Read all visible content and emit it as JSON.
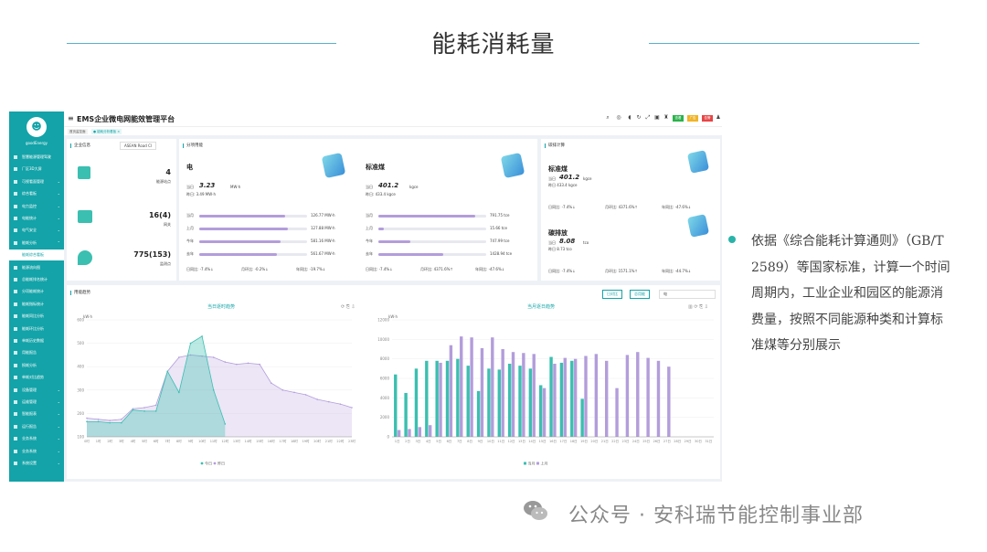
{
  "slide": {
    "title": "能耗消耗量",
    "bullet": [
      "依据《综合能耗计算通则》（GB/T",
      "2589）等国家标准，计算一个时间",
      "周期内，工业企业和园区的能源消",
      "费量，按照不同能源种类和计算标",
      "准煤等分别展示"
    ],
    "watermark": "公众号 · 安科瑞节能控制事业部",
    "accent": "#2ab3a8"
  },
  "app": {
    "title": "EMS企业微电网能效管理平台",
    "logo_name": "goodEnergy",
    "tabs": [
      "首页监控面",
      "● 能耗分析看板 ×"
    ],
    "sidebar": [
      {
        "label": "智慧能源管理驾驶",
        "chev": "",
        "active": false
      },
      {
        "label": "厂区3D大屏",
        "chev": "",
        "active": false
      },
      {
        "label": "可视看面管理",
        "chev": "⌄",
        "active": false
      },
      {
        "label": "综合看板",
        "chev": "⌄",
        "active": false
      },
      {
        "label": "电力监控",
        "chev": "⌄",
        "active": false
      },
      {
        "label": "电能统计",
        "chev": "⌄",
        "active": false
      },
      {
        "label": "电气安全",
        "chev": "⌄",
        "active": false
      },
      {
        "label": "能耗分析",
        "chev": "⌃",
        "active": false
      },
      {
        "label": "能耗综合看板",
        "chev": "",
        "active": true
      },
      {
        "label": "能源流向图",
        "chev": "",
        "active": false
      },
      {
        "label": "总能耗排名统计",
        "chev": "",
        "active": false
      },
      {
        "label": "分项能耗统计",
        "chev": "",
        "active": false
      },
      {
        "label": "能耗指标统计",
        "chev": "",
        "active": false
      },
      {
        "label": "能耗同比分析",
        "chev": "",
        "active": false
      },
      {
        "label": "能耗环比分析",
        "chev": "",
        "active": false
      },
      {
        "label": "单耗历史数据",
        "chev": "",
        "active": false
      },
      {
        "label": "用能报告",
        "chev": "",
        "active": false
      },
      {
        "label": "损耗分析",
        "chev": "",
        "active": false
      },
      {
        "label": "单耗对比趋势",
        "chev": "",
        "active": false
      },
      {
        "label": "设备管理",
        "chev": "⌄",
        "active": false
      },
      {
        "label": "运维管理",
        "chev": "⌄",
        "active": false
      },
      {
        "label": "智能报表",
        "chev": "⌄",
        "active": false
      },
      {
        "label": "运行报告",
        "chev": "⌄",
        "active": false
      },
      {
        "label": "业务系统",
        "chev": "⌄",
        "active": false
      },
      {
        "label": "业务系统",
        "chev": "⌄",
        "active": false
      },
      {
        "label": "系统设置",
        "chev": "⌄",
        "active": false
      }
    ],
    "badges": [
      {
        "label": "查看",
        "color": "#2ab34b"
      },
      {
        "label": "广告",
        "color": "#f0b428"
      },
      {
        "label": "告警",
        "color": "#e84545"
      }
    ],
    "enterprise": {
      "title": "企业信息",
      "name": "ASEAN Road Cl",
      "stats": [
        {
          "value": "4",
          "label": "能源站点"
        },
        {
          "value": "16(4)",
          "label": "网关"
        },
        {
          "value": "775(153)",
          "label": "监测点"
        }
      ]
    },
    "energy": {
      "title": "分项用能",
      "items": [
        {
          "name": "电",
          "today_label": "当日",
          "today_value": "3.23",
          "today_unit": "MW·h",
          "yest": "昨日: 3.49 MW·h",
          "rows": [
            {
              "k": "当月",
              "v": "126.77 MW·h",
              "p": 0.8
            },
            {
              "k": "上月",
              "v": "127.88 MW·h",
              "p": 0.82
            },
            {
              "k": "今年",
              "v": "581.16 MW·h",
              "p": 0.75
            },
            {
              "k": "去年",
              "v": "561.67 MW·h",
              "p": 0.72
            }
          ],
          "ratios": [
            "日同比: -7.4%↓",
            "月环比: -0.2%↓",
            "年同比: -19.7%↓"
          ]
        },
        {
          "name": "标准煤",
          "today_label": "当日",
          "today_value": "401.2",
          "today_unit": "kgce",
          "yest": "昨日: 433.4 kgce",
          "rows": [
            {
              "k": "当月",
              "v": "791.75 tce",
              "p": 0.9
            },
            {
              "k": "上月",
              "v": "15.66 tce",
              "p": 0.05
            },
            {
              "k": "今年",
              "v": "747.99 tce",
              "p": 0.3
            },
            {
              "k": "去年",
              "v": "1428.94 tce",
              "p": 0.6
            }
          ],
          "ratios": [
            "日同比: -7.4%↓",
            "月环比: 4371.6%↑",
            "年同比: -47.6%↓"
          ]
        }
      ]
    },
    "carbon": {
      "title": "碳排计算",
      "items": [
        {
          "name": "标准煤",
          "today_label": "当日",
          "today_value": "401.2",
          "today_unit": "kgce",
          "yest": "昨日 433.4 kgce",
          "ratios": [
            "日同比: -7.4%↓",
            "月环比: 4371.6%↑",
            "年同比: -47.6%↓"
          ]
        },
        {
          "name": "碳排放",
          "today_label": "当日",
          "today_value": "8.08",
          "today_unit": "tco",
          "yest": "昨日 8.73 tco",
          "ratios": [
            "日同比: -7.4%↓",
            "月环比: 1571.1%↑",
            "年同比: -44.7%↓"
          ]
        }
      ]
    },
    "trend": {
      "title": "用能趋势",
      "btn1": "日对比",
      "btn2": "总用能",
      "select": "电",
      "day_title": "当日逐时趋势",
      "month_title": "当月逐日趋势",
      "unit_left": "kW·h",
      "unit_right": "kW·h",
      "legend_left": [
        "今日",
        "昨日"
      ],
      "legend_right": [
        "当月",
        "上月"
      ]
    }
  },
  "chart_data": [
    {
      "type": "area",
      "title": "当日逐时趋势",
      "ylabel": "kW·h",
      "ylim": [
        100,
        600
      ],
      "x": [
        "0时",
        "1时",
        "2时",
        "3时",
        "4时",
        "5时",
        "6时",
        "7时",
        "8时",
        "9时",
        "10时",
        "11时",
        "12时",
        "13时",
        "14时",
        "15时",
        "16时",
        "17时",
        "18时",
        "19时",
        "20时",
        "21时",
        "22时",
        "23时"
      ],
      "series": [
        {
          "name": "今日",
          "values": [
            165,
            165,
            160,
            160,
            215,
            210,
            210,
            380,
            290,
            500,
            530,
            300,
            155,
            null,
            null,
            null,
            null,
            null,
            null,
            null,
            null,
            null,
            null,
            null
          ]
        },
        {
          "name": "昨日",
          "values": [
            180,
            175,
            170,
            175,
            220,
            225,
            235,
            380,
            440,
            450,
            445,
            440,
            420,
            410,
            415,
            410,
            330,
            300,
            290,
            280,
            260,
            250,
            240,
            225
          ]
        }
      ]
    },
    {
      "type": "bar",
      "title": "当月逐日趋势",
      "ylabel": "kW·h",
      "ylim": [
        0,
        12000
      ],
      "x": [
        "1日",
        "2日",
        "3日",
        "4日",
        "5日",
        "6日",
        "7日",
        "8日",
        "9日",
        "10日",
        "11日",
        "12日",
        "13日",
        "14日",
        "15日",
        "16日",
        "17日",
        "18日",
        "19日",
        "20日",
        "21日",
        "22日",
        "23日",
        "24日",
        "25日",
        "26日",
        "27日",
        "28日",
        "29日",
        "30日",
        "31日"
      ],
      "series": [
        {
          "name": "当月",
          "values": [
            6400,
            4500,
            7000,
            7800,
            7800,
            7800,
            8000,
            7300,
            4700,
            7000,
            6900,
            7500,
            7300,
            7000,
            5300,
            8200,
            7600,
            7800,
            3900,
            null,
            null,
            null,
            null,
            null,
            null,
            null,
            null,
            null,
            null,
            null,
            null
          ]
        },
        {
          "name": "上月",
          "values": [
            700,
            800,
            1000,
            1200,
            7600,
            9400,
            10300,
            10200,
            9100,
            10200,
            9000,
            8700,
            8600,
            8500,
            5000,
            7500,
            8100,
            8000,
            8300,
            8500,
            7800,
            5000,
            8400,
            8700,
            8100,
            7800,
            7200,
            null,
            null,
            null,
            null
          ]
        }
      ]
    }
  ]
}
